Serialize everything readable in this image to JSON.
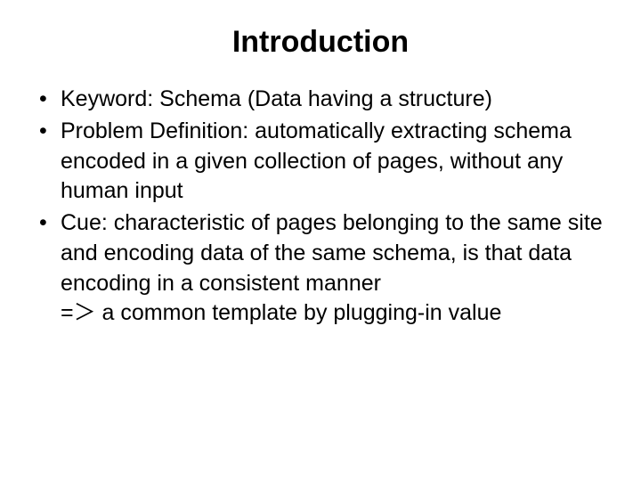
{
  "title": "Introduction",
  "bullets": [
    "Keyword: Schema (Data having a structure)",
    "Problem Definition: automatically extracting schema encoded in a given collection of pages, without any human input",
    "Cue: characteristic of pages belonging to the same site and encoding data of the same schema, is that data encoding in a consistent manner"
  ],
  "continuation": "=＞ a common template by plugging-in value"
}
